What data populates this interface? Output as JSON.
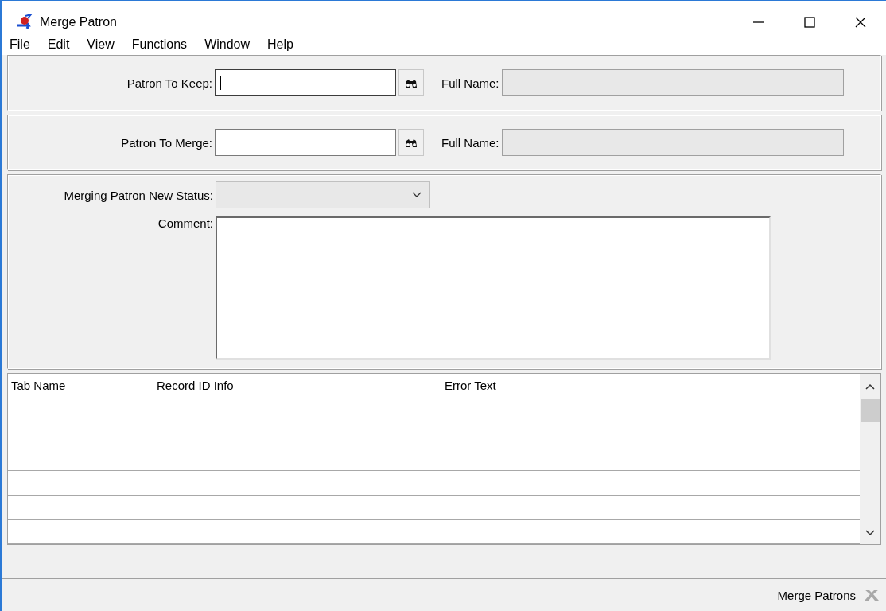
{
  "window": {
    "title": "Merge Patron"
  },
  "menu": [
    "File",
    "Edit",
    "View",
    "Functions",
    "Window",
    "Help"
  ],
  "patron_panels": [
    {
      "label": "Patron To Keep:",
      "focused": true,
      "full_name_label": "Full Name:",
      "full_name_disabled": true
    },
    {
      "label": "Patron To Merge:",
      "focused": false,
      "full_name_label": "Full Name:",
      "full_name_disabled": true
    }
  ],
  "status_field": {
    "label": "Merging Patron New Status:",
    "disabled": true
  },
  "comment": {
    "label": "Comment:"
  },
  "table": {
    "columns": [
      "Tab Name",
      "Record ID Info",
      "Error Text"
    ]
  },
  "status_bar": {
    "text": "Merge Patrons"
  }
}
